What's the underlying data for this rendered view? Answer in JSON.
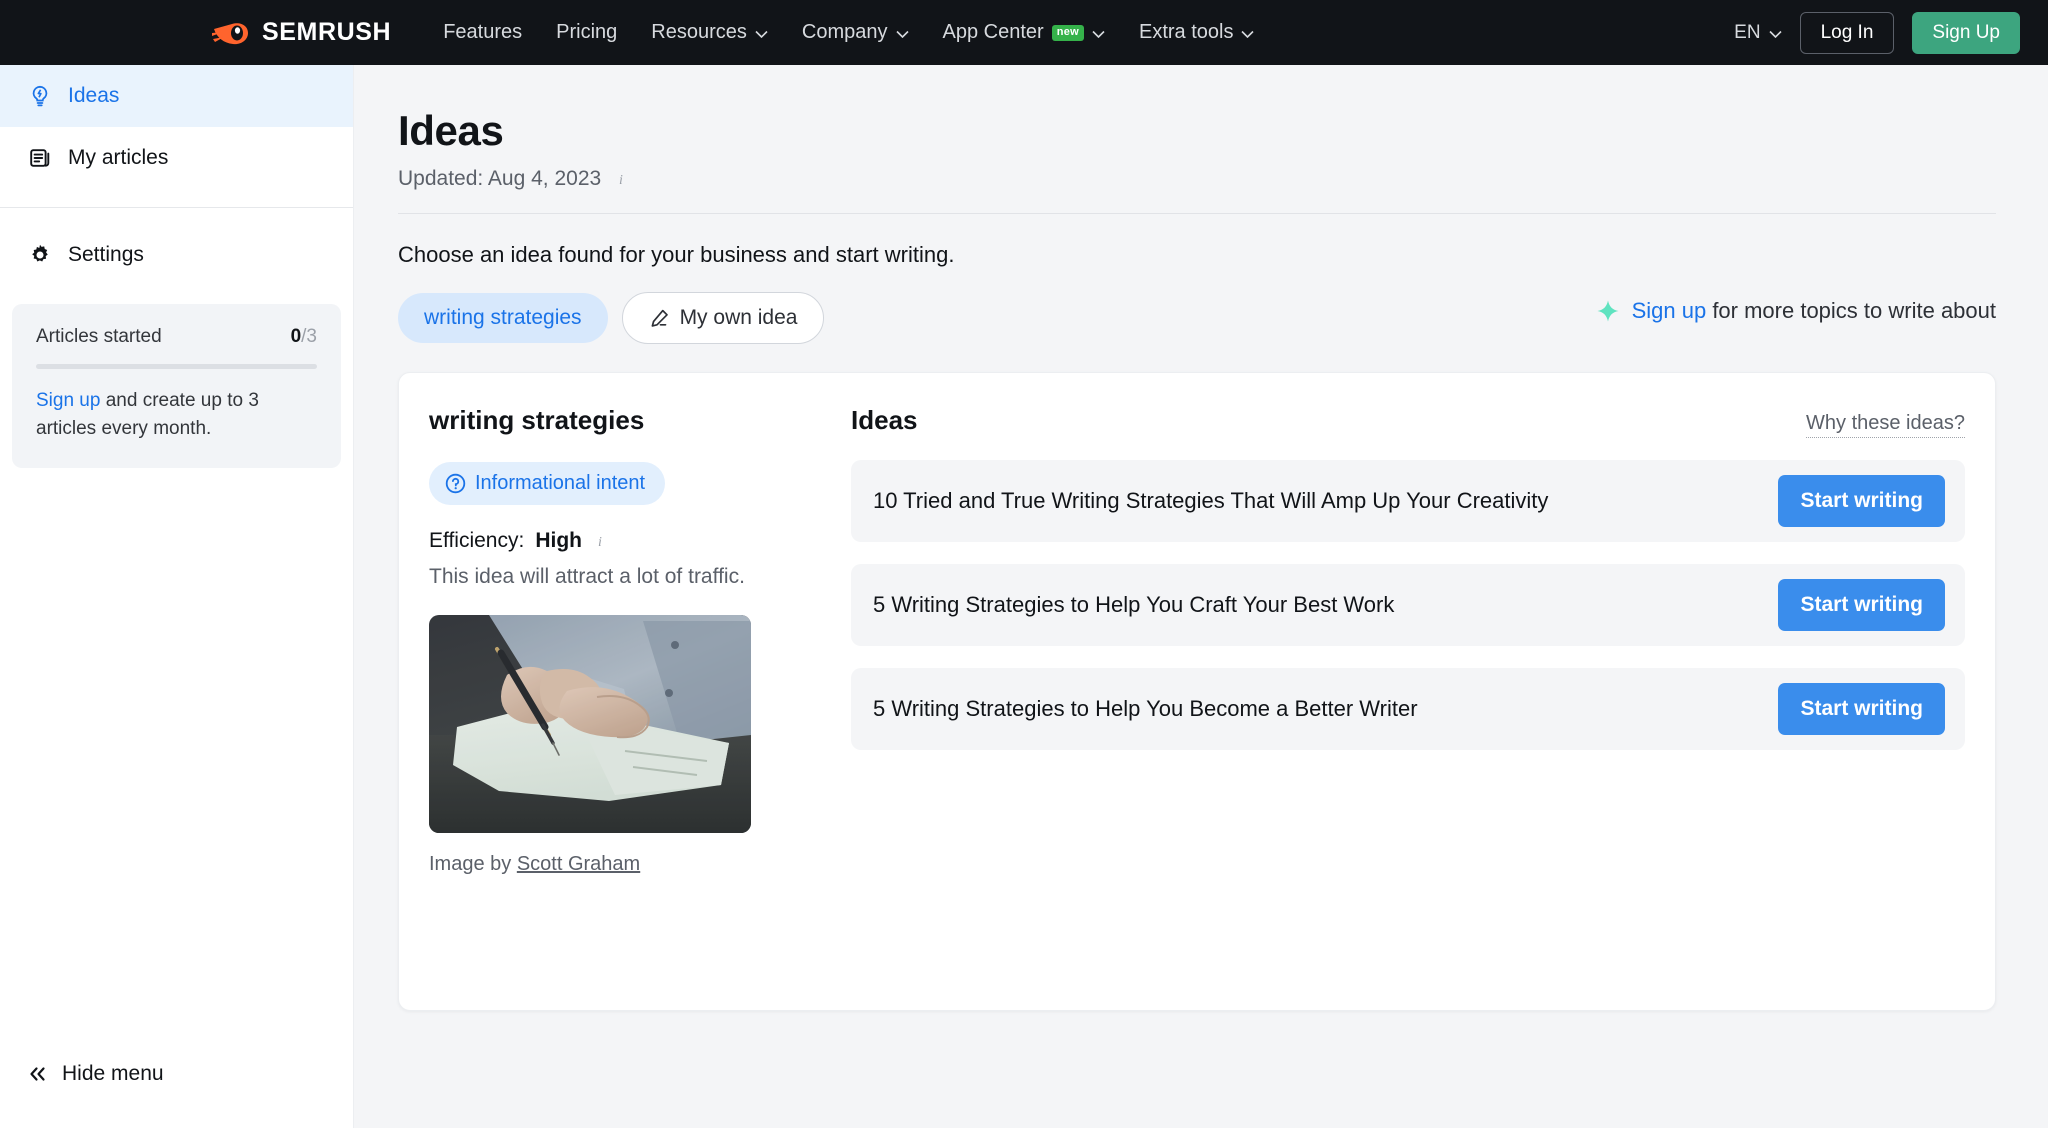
{
  "topnav": {
    "brand": "SEMRUSH",
    "brand_logo_icon": "semrush-logo-icon",
    "links": [
      {
        "label": "Features",
        "has_chevron": false,
        "badge": ""
      },
      {
        "label": "Pricing",
        "has_chevron": false,
        "badge": ""
      },
      {
        "label": "Resources",
        "has_chevron": true,
        "badge": ""
      },
      {
        "label": "Company",
        "has_chevron": true,
        "badge": ""
      },
      {
        "label": "App Center",
        "has_chevron": true,
        "badge": "new"
      },
      {
        "label": "Extra tools",
        "has_chevron": true,
        "badge": ""
      }
    ],
    "language": "EN",
    "login_label": "Log In",
    "signup_label": "Sign Up",
    "colors": {
      "bar": "#111418",
      "signup": "#3da57f",
      "badge_new": "#35b24a"
    }
  },
  "sidebar": {
    "items": [
      {
        "label": "Ideas",
        "icon": "lightbulb-idea-icon",
        "active": true
      },
      {
        "label": "My articles",
        "icon": "document-list-icon",
        "active": false
      },
      {
        "label": "Settings",
        "icon": "gear-icon",
        "active": false
      }
    ],
    "quota": {
      "label": "Articles started",
      "used": "0",
      "total": "/3",
      "progress_percent": 0,
      "cta_link": "Sign up",
      "cta_rest": " and create up to 3 articles every month."
    },
    "hide_menu_label": "Hide menu",
    "hide_menu_icon": "double-chevron-left-icon",
    "active_color": "#1a73e8",
    "active_bg": "#e9f3fd"
  },
  "main": {
    "page_title": "Ideas",
    "updated_text": "Updated: Aug 4, 2023",
    "updated_info_icon": "info-icon",
    "choose_line": "Choose an idea found for your business and start writing.",
    "chips": [
      {
        "label": "writing strategies",
        "active": true,
        "icon": ""
      },
      {
        "label": "My own idea",
        "active": false,
        "icon": "pencil-edit-icon"
      }
    ],
    "signup_banner": {
      "icon": "sparkle-star-icon",
      "link": "Sign up",
      "rest": " for more topics to write about"
    }
  },
  "idea_detail": {
    "keyword": "writing strategies",
    "intent_icon": "question-circle-icon",
    "intent_label": "Informational intent",
    "efficiency_prefix": "Efficiency: ",
    "efficiency_value": "High",
    "efficiency_info_icon": "info-icon",
    "efficiency_sub": "This idea will attract a lot of traffic.",
    "image_alt": "hand-writing-on-paper-photo",
    "credit_prefix": "Image by ",
    "credit_author": "Scott Graham"
  },
  "ideas_panel": {
    "title": "Ideas",
    "why_link": "Why these ideas?",
    "button_label": "Start writing",
    "button_color": "#3a8dec",
    "rows": [
      {
        "title": "10 Tried and True Writing Strategies That Will Amp Up Your Creativity"
      },
      {
        "title": "5 Writing Strategies to Help You Craft Your Best Work"
      },
      {
        "title": "5 Writing Strategies to Help You Become a Better Writer"
      }
    ]
  }
}
